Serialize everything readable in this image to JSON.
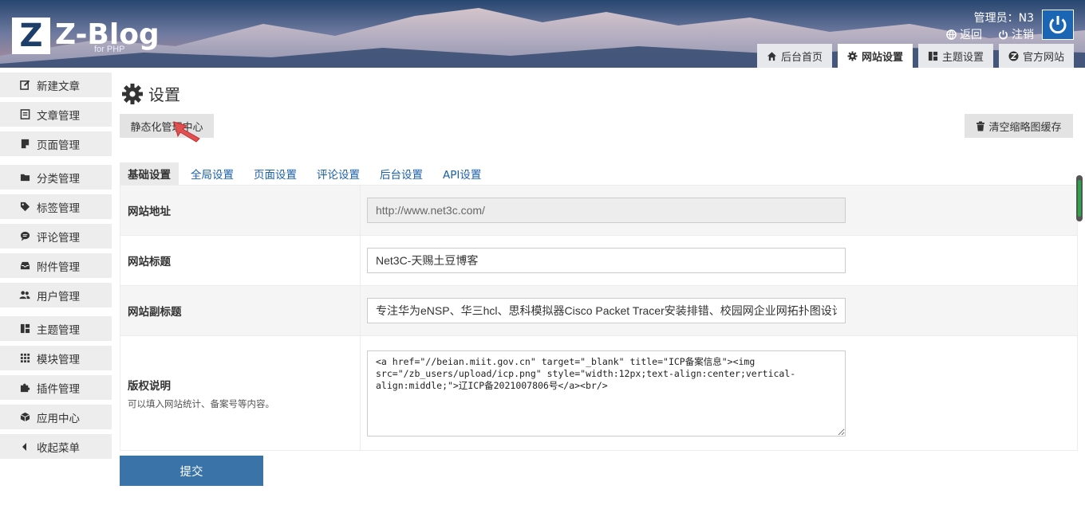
{
  "header": {
    "logo_letter": "Z",
    "logo_text": "Z-Blog",
    "logo_sub": "for PHP",
    "admin_label": "管理员：N3",
    "links": [
      {
        "label": "返回",
        "icon": "globe-icon"
      },
      {
        "label": "注销",
        "icon": "power-icon"
      }
    ],
    "tabs": [
      {
        "label": "后台首页",
        "icon": "home-icon",
        "active": false
      },
      {
        "label": "网站设置",
        "icon": "gear-icon",
        "active": true
      },
      {
        "label": "主题设置",
        "icon": "layout-icon",
        "active": false
      },
      {
        "label": "官方网站",
        "icon": "zblog-icon",
        "active": false
      }
    ]
  },
  "sidebar": {
    "items": [
      {
        "label": "新建文章",
        "icon": "edit-icon"
      },
      {
        "label": "文章管理",
        "icon": "article-icon"
      },
      {
        "label": "页面管理",
        "icon": "page-icon"
      },
      {
        "label": "分类管理",
        "icon": "folder-icon"
      },
      {
        "label": "标签管理",
        "icon": "tag-icon"
      },
      {
        "label": "评论管理",
        "icon": "comment-icon"
      },
      {
        "label": "附件管理",
        "icon": "inbox-icon"
      },
      {
        "label": "用户管理",
        "icon": "users-icon"
      },
      {
        "label": "主题管理",
        "icon": "layout-icon"
      },
      {
        "label": "模块管理",
        "icon": "grid-icon"
      },
      {
        "label": "插件管理",
        "icon": "puzzle-icon"
      },
      {
        "label": "应用中心",
        "icon": "box-icon"
      },
      {
        "label": "收起菜单",
        "icon": "caret-left-icon"
      }
    ]
  },
  "main": {
    "title": "设置",
    "static_button": "静态化管理中心",
    "clear_button": "清空缩略图缓存",
    "tabs": [
      "基础设置",
      "全局设置",
      "页面设置",
      "评论设置",
      "后台设置",
      "API设置"
    ],
    "fields": {
      "site_url": {
        "label": "网站地址",
        "value": "http://www.net3c.com/"
      },
      "site_title": {
        "label": "网站标题",
        "value": "Net3C-天赐土豆博客"
      },
      "site_subtitle": {
        "label": "网站副标题",
        "value": "专注华为eNSP、华三hcl、思科模拟器Cisco Packet Tracer安装排错、校园网企业网拓扑图设计"
      },
      "copyright": {
        "label": "版权说明",
        "hint": "可以填入网站统计、备案号等内容。",
        "value": "<a href=\"//beian.miit.gov.cn\" target=\"_blank\" title=\"ICP备案信息\"><img src=\"/zb_users/upload/icp.png\" style=\"width:12px;text-align:center;vertical-align:middle;\">辽ICP备2021007806号</a><br/>"
      }
    },
    "submit_label": "提交"
  },
  "colors": {
    "submit_bg": "#3a73a8",
    "link": "#1a5fa8",
    "power_bg": "#1a66b5"
  }
}
